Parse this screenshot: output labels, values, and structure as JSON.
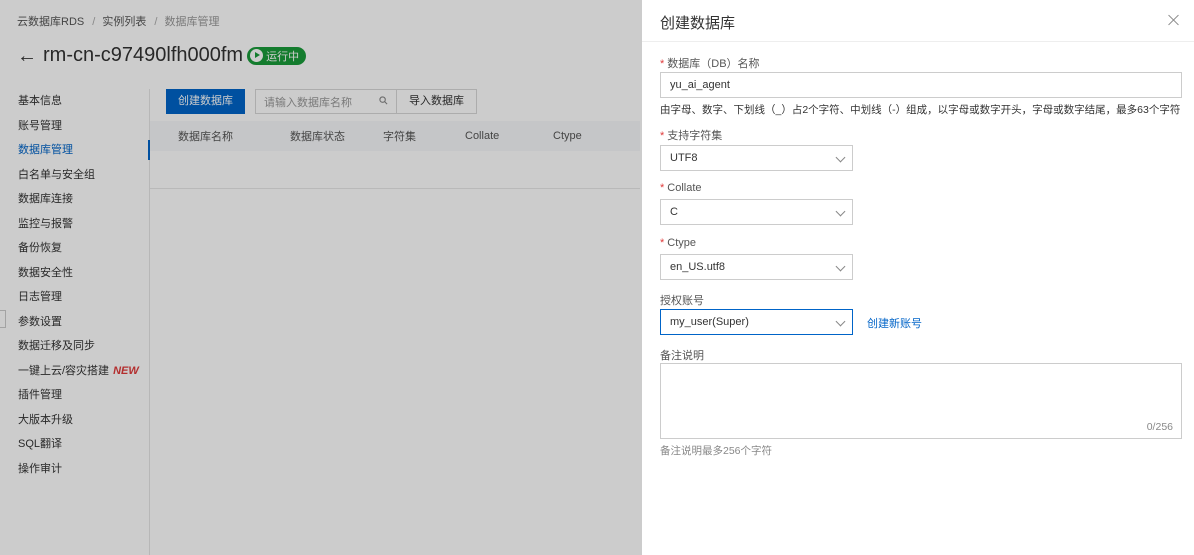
{
  "breadcrumb": {
    "item1": "云数据库RDS",
    "item2": "实例列表",
    "item3": "数据库管理"
  },
  "instance": {
    "id": "rm-cn-c97490lfh000fm",
    "status": "运行中"
  },
  "sidebar": {
    "items": [
      "基本信息",
      "账号管理",
      "数据库管理",
      "白名单与安全组",
      "数据库连接",
      "监控与报警",
      "备份恢复",
      "数据安全性",
      "日志管理",
      "参数设置",
      "数据迁移及同步",
      "一键上云/容灾搭建",
      "插件管理",
      "大版本升级",
      "SQL翻译",
      "操作审计"
    ],
    "active_index": 2,
    "new_badge": "NEW"
  },
  "toolbar": {
    "create_label": "创建数据库",
    "search_placeholder": "请输入数据库名称",
    "import_label": "导入数据库"
  },
  "table": {
    "columns": [
      "数据库名称",
      "数据库状态",
      "字符集",
      "Collate",
      "Ctype"
    ]
  },
  "drawer": {
    "title": "创建数据库",
    "db_name": {
      "label": "数据库（DB）名称",
      "value": "yu_ai_agent",
      "hint": "由字母、数字、下划线（_）占2个字符、中划线（-）组成，以字母或数字开头，字母或数字结尾，最多63个字符"
    },
    "charset": {
      "label": "支持字符集",
      "value": "UTF8"
    },
    "collate": {
      "label": "Collate",
      "value": "C"
    },
    "ctype": {
      "label": "Ctype",
      "value": "en_US.utf8"
    },
    "account": {
      "label": "授权账号",
      "value": "my_user(Super)",
      "link": "创建新账号"
    },
    "remark": {
      "label": "备注说明",
      "counter": "0/256",
      "hint": "备注说明最多256个字符"
    }
  },
  "colors": {
    "accent": "#0064c8",
    "status_green": "#1a9b3a",
    "required_red": "#e03a3a"
  }
}
